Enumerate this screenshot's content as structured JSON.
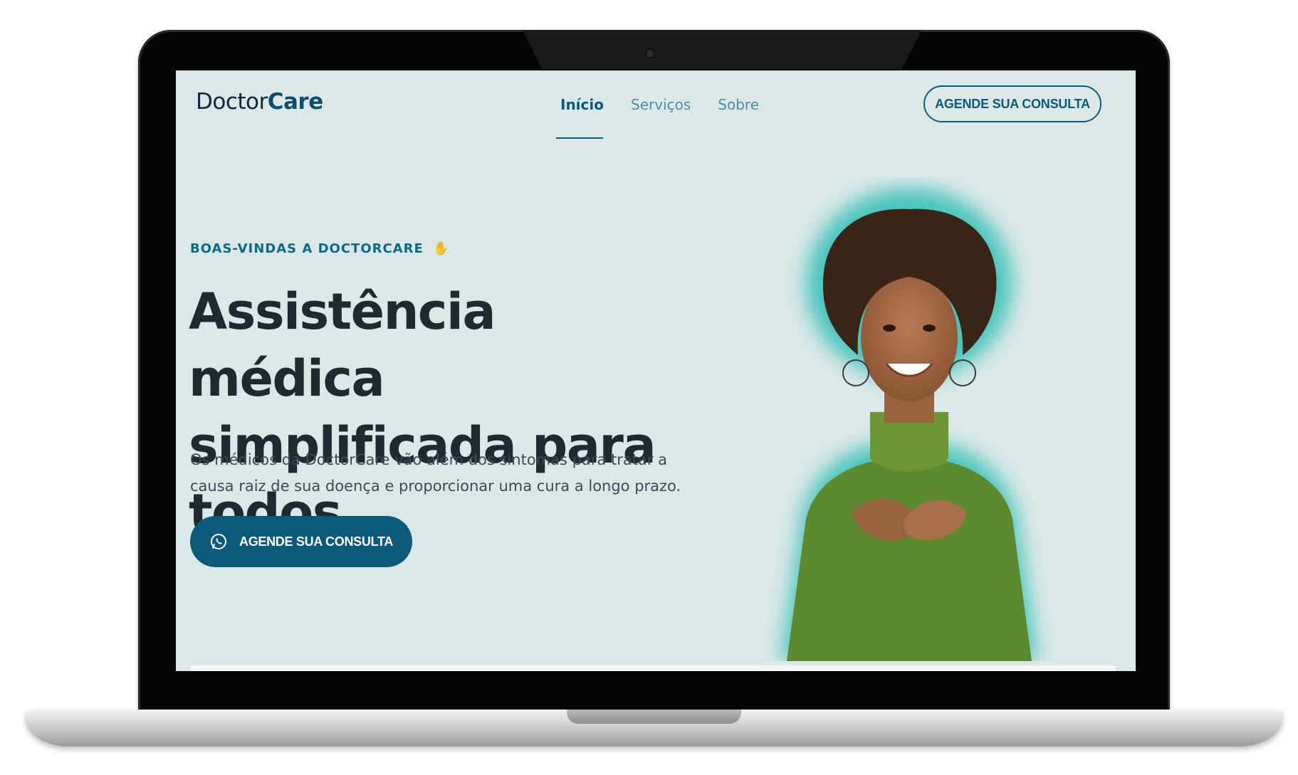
{
  "brand": {
    "name_regular": "Doctor",
    "name_bold": "Care"
  },
  "nav": {
    "items": [
      {
        "label": "Início",
        "active": true
      },
      {
        "label": "Serviços",
        "active": false
      },
      {
        "label": "Sobre",
        "active": false
      }
    ]
  },
  "header": {
    "cta_label": "AGENDE SUA CONSULTA"
  },
  "hero": {
    "eyebrow": "BOAS-VINDAS A DOCTORCARE",
    "eyebrow_icon": "waving-hand-icon",
    "headline": "Assistência médica simplificada para todos",
    "description": "Os médicos da DoctorCare vão além dos sintomas para tratar a causa raiz de sua doença e proporcionar uma cura a longo prazo.",
    "cta_label": "AGENDE SUA CONSULTA",
    "cta_icon": "whatsapp-icon"
  },
  "colors": {
    "background": "#dce8e8",
    "primary": "#0b5a7a",
    "accent_glow": "#2fbfb3",
    "sweater": "#5e8a2f"
  }
}
